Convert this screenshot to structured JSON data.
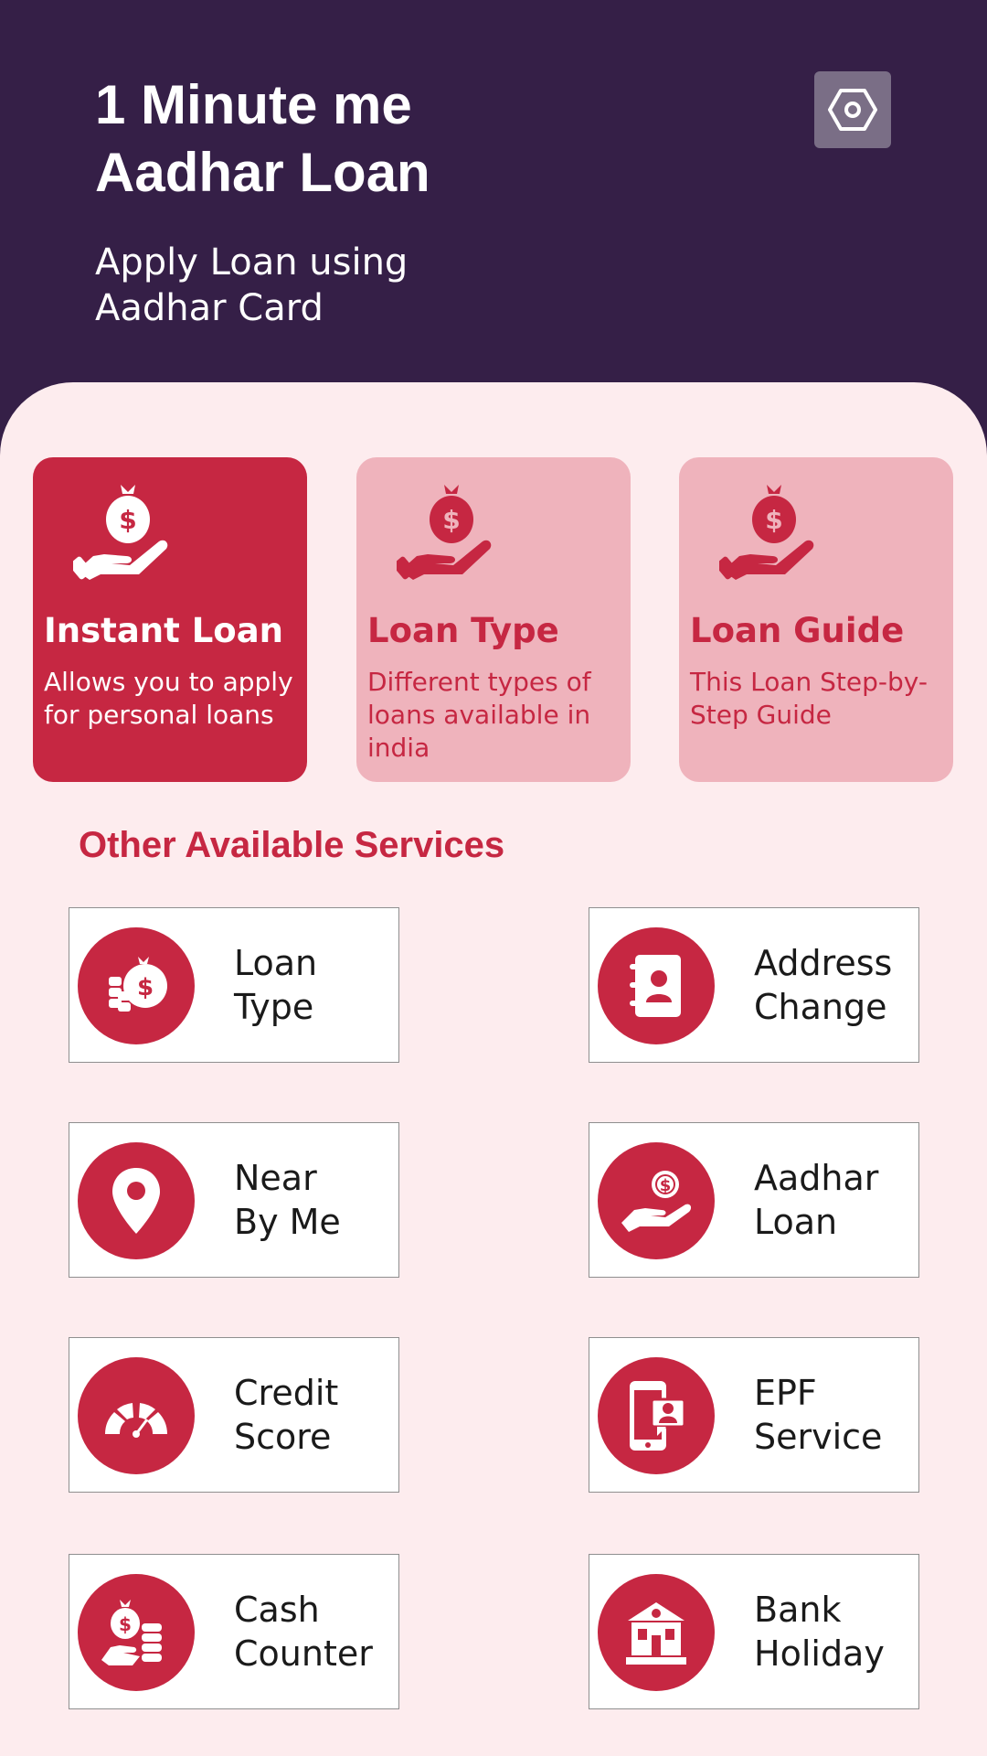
{
  "header": {
    "title": "1 Minute me Aadhar Loan",
    "subtitle": "Apply Loan using Aadhar Card",
    "settings_icon": "settings-hexagon-icon"
  },
  "feature_cards": [
    {
      "title": "Instant Loan",
      "description": "Allows you to apply for personal loans",
      "icon": "money-bag-hand-icon",
      "active": true
    },
    {
      "title": "Loan Type",
      "description": "Different types of loans available in india",
      "icon": "money-bag-hand-icon",
      "active": false
    },
    {
      "title": "Loan Guide",
      "description": "This Loan Step-by-Step Guide",
      "icon": "money-bag-hand-icon",
      "active": false
    }
  ],
  "services": {
    "title": "Other Available Services",
    "items": [
      {
        "label": "Loan\nType",
        "icon": "money-bags-icon"
      },
      {
        "label": "Address\nChange",
        "icon": "address-book-icon"
      },
      {
        "label": "Near\nBy Me",
        "icon": "location-pin-icon"
      },
      {
        "label": "Aadhar\nLoan",
        "icon": "coin-hand-icon"
      },
      {
        "label": "Credit\nScore",
        "icon": "gauge-icon"
      },
      {
        "label": "EPF\nService",
        "icon": "phone-profile-icon"
      },
      {
        "label": "Cash\nCounter",
        "icon": "cash-coins-icon"
      },
      {
        "label": "Bank\nHoliday",
        "icon": "bank-building-icon"
      }
    ]
  },
  "colors": {
    "header_bg": "#351f47",
    "accent": "#c62742",
    "accent_light": "#efb3bc",
    "page_bg": "#fdecee"
  }
}
